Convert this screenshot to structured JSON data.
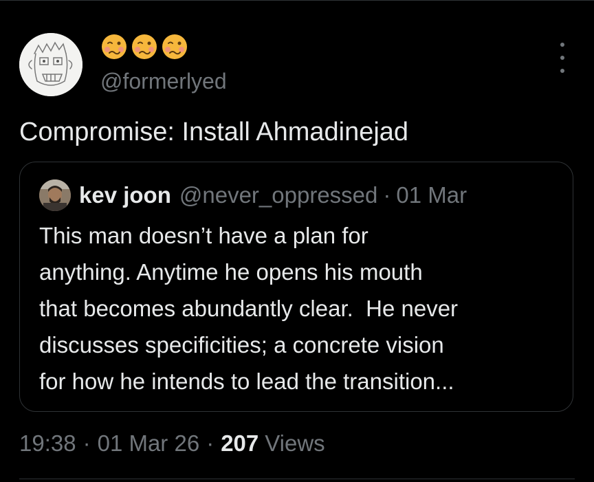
{
  "author": {
    "display_name_emojis": [
      "woozy-face-emoji",
      "woozy-face-emoji",
      "woozy-face-emoji"
    ],
    "handle": "@formerlyed"
  },
  "tweet": {
    "text": "Compromise: Install Ahmadinejad"
  },
  "quote": {
    "name": "kev joon",
    "handle": "@never_oppressed",
    "separator": "·",
    "date": "01 Mar",
    "lines": [
      "This man doesn’t have a plan for",
      "anything. Anytime he opens his mouth",
      "that becomes abundantly clear.  He never",
      "discusses specificities; a concrete vision",
      "for how he intends to lead the transition..."
    ]
  },
  "meta": {
    "time": "19:38",
    "date": "01 Mar 26",
    "separator": "·",
    "views_count": "207",
    "views_label": "Views"
  },
  "colors": {
    "background": "#000000",
    "text_primary": "#e7e9ea",
    "text_secondary": "#71767b",
    "border": "#2f3336",
    "emoji_face": "#f6b73c"
  },
  "icons": {
    "more": "more-vertical-icon"
  }
}
